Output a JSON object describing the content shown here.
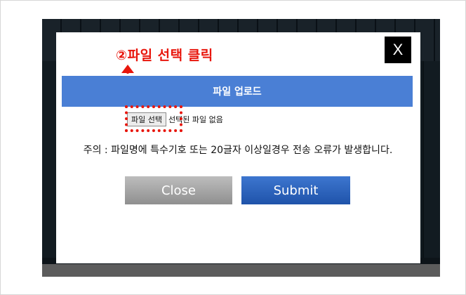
{
  "annotation": {
    "callout_text": "②파일 선택 클릭",
    "color": "#e8160c"
  },
  "modal": {
    "close_symbol": "X",
    "title": "파일 업로드",
    "file_button_label": "파일 선택",
    "file_status": "선택된 파일 없음",
    "notice": "주의 : 파일명에 특수기호 또는 20글자 이상일경우 전송 오류가 발생합니다.",
    "close_button_label": "Close",
    "submit_button_label": "Submit",
    "title_bar_color": "#4a7fd5",
    "submit_color": "#2a5fb8"
  }
}
